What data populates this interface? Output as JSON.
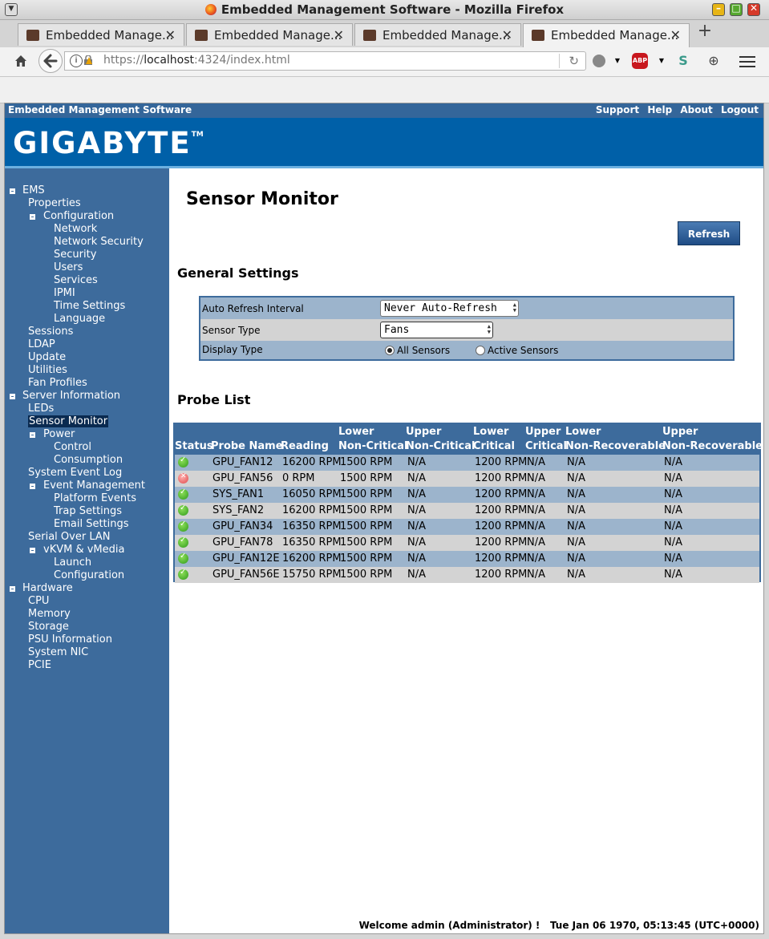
{
  "window": {
    "title": "Embedded Management Software - Mozilla Firefox"
  },
  "browser": {
    "tabs": [
      {
        "label": "Embedded Manage...",
        "active": false
      },
      {
        "label": "Embedded Manage...",
        "active": false
      },
      {
        "label": "Embedded Manage...",
        "active": false
      },
      {
        "label": "Embedded Manage...",
        "active": true
      }
    ],
    "url_scheme": "https://",
    "url_host": "localhost",
    "url_rest": ":4324/index.html",
    "abp_label": "ABP",
    "s_label": "S"
  },
  "app": {
    "title": "Embedded Management Software",
    "links": [
      "Support",
      "Help",
      "About",
      "Logout"
    ],
    "logo": "GIGABYTE",
    "logo_tm": "TM"
  },
  "sidebar": {
    "items": [
      {
        "label": "EMS",
        "level": 0,
        "toggle": true
      },
      {
        "label": "Properties",
        "level": 1
      },
      {
        "label": "Configuration",
        "level": 1,
        "toggle": true
      },
      {
        "label": "Network",
        "level": 2
      },
      {
        "label": "Network Security",
        "level": 2
      },
      {
        "label": "Security",
        "level": 2
      },
      {
        "label": "Users",
        "level": 2
      },
      {
        "label": "Services",
        "level": 2
      },
      {
        "label": "IPMI",
        "level": 2
      },
      {
        "label": "Time Settings",
        "level": 2
      },
      {
        "label": "Language",
        "level": 2
      },
      {
        "label": "Sessions",
        "level": 1
      },
      {
        "label": "LDAP",
        "level": 1
      },
      {
        "label": "Update",
        "level": 1
      },
      {
        "label": "Utilities",
        "level": 1
      },
      {
        "label": "Fan Profiles",
        "level": 1
      },
      {
        "label": "Server Information",
        "level": 0,
        "toggle": true
      },
      {
        "label": "LEDs",
        "level": 1
      },
      {
        "label": "Sensor Monitor",
        "level": 1,
        "selected": true
      },
      {
        "label": "Power",
        "level": 1,
        "toggle": true
      },
      {
        "label": "Control",
        "level": 2
      },
      {
        "label": "Consumption",
        "level": 2
      },
      {
        "label": "System Event Log",
        "level": 1
      },
      {
        "label": "Event Management",
        "level": 1,
        "toggle": true
      },
      {
        "label": "Platform Events",
        "level": 2
      },
      {
        "label": "Trap Settings",
        "level": 2
      },
      {
        "label": "Email Settings",
        "level": 2
      },
      {
        "label": "Serial Over LAN",
        "level": 1
      },
      {
        "label": "vKVM & vMedia",
        "level": 1,
        "toggle": true
      },
      {
        "label": "Launch",
        "level": 2
      },
      {
        "label": "Configuration",
        "level": 2
      },
      {
        "label": "Hardware",
        "level": 0,
        "toggle": true
      },
      {
        "label": "CPU",
        "level": 1
      },
      {
        "label": "Memory",
        "level": 1
      },
      {
        "label": "Storage",
        "level": 1
      },
      {
        "label": "PSU Information",
        "level": 1
      },
      {
        "label": "System NIC",
        "level": 1
      },
      {
        "label": "PCIE",
        "level": 1
      }
    ]
  },
  "main": {
    "title": "Sensor Monitor",
    "refresh_label": "Refresh",
    "general_heading": "General Settings",
    "settings": {
      "auto_refresh_label": "Auto Refresh Interval",
      "auto_refresh_value": "Never Auto-Refresh",
      "sensor_type_label": "Sensor Type",
      "sensor_type_value": "Fans",
      "display_type_label": "Display Type",
      "display_all": "All Sensors",
      "display_active": "Active Sensors",
      "display_selected": "All Sensors"
    },
    "probe_heading": "Probe List",
    "columns": [
      {
        "line1": "",
        "line2": "Status"
      },
      {
        "line1": "",
        "line2": "Probe Name"
      },
      {
        "line1": "",
        "line2": "Reading"
      },
      {
        "line1": "Lower",
        "line2": "Non-Critical"
      },
      {
        "line1": "Upper",
        "line2": "Non-Critical"
      },
      {
        "line1": "Lower",
        "line2": "Critical"
      },
      {
        "line1": "Upper",
        "line2": "Critical"
      },
      {
        "line1": "Lower",
        "line2": "Non-Recoverable"
      },
      {
        "line1": "Upper",
        "line2": "Non-Recoverable"
      }
    ],
    "rows": [
      {
        "status": "ok",
        "name": "GPU_FAN12",
        "reading": "16200 RPM",
        "lnc": "1500 RPM",
        "unc": "N/A",
        "lc": "1200 RPM",
        "uc": "N/A",
        "lnr": "N/A",
        "unr": "N/A"
      },
      {
        "status": "critical",
        "name": "GPU_FAN56",
        "reading": "0 RPM",
        "lnc": "1500 RPM",
        "unc": "N/A",
        "lc": "1200 RPM",
        "uc": "N/A",
        "lnr": "N/A",
        "unr": "N/A"
      },
      {
        "status": "ok",
        "name": "SYS_FAN1",
        "reading": "16050 RPM",
        "lnc": "1500 RPM",
        "unc": "N/A",
        "lc": "1200 RPM",
        "uc": "N/A",
        "lnr": "N/A",
        "unr": "N/A"
      },
      {
        "status": "ok",
        "name": "SYS_FAN2",
        "reading": "16200 RPM",
        "lnc": "1500 RPM",
        "unc": "N/A",
        "lc": "1200 RPM",
        "uc": "N/A",
        "lnr": "N/A",
        "unr": "N/A"
      },
      {
        "status": "ok",
        "name": "GPU_FAN34",
        "reading": "16350 RPM",
        "lnc": "1500 RPM",
        "unc": "N/A",
        "lc": "1200 RPM",
        "uc": "N/A",
        "lnr": "N/A",
        "unr": "N/A"
      },
      {
        "status": "ok",
        "name": "GPU_FAN78",
        "reading": "16350 RPM",
        "lnc": "1500 RPM",
        "unc": "N/A",
        "lc": "1200 RPM",
        "uc": "N/A",
        "lnr": "N/A",
        "unr": "N/A"
      },
      {
        "status": "ok",
        "name": "GPU_FAN12E",
        "reading": "16200 RPM",
        "lnc": "1500 RPM",
        "unc": "N/A",
        "lc": "1200 RPM",
        "uc": "N/A",
        "lnr": "N/A",
        "unr": "N/A"
      },
      {
        "status": "ok",
        "name": "GPU_FAN56E",
        "reading": "15750 RPM",
        "lnc": "1500 RPM",
        "unc": "N/A",
        "lc": "1200 RPM",
        "uc": "N/A",
        "lnr": "N/A",
        "unr": "N/A"
      }
    ]
  },
  "footer": {
    "welcome": "Welcome admin (Administrator) !",
    "datetime": "Tue Jan 06 1970, 05:13:45 (UTC+0000)"
  },
  "colors": {
    "sidebar": "#3d6b9c",
    "banner": "#0060a8",
    "header": "#34669a"
  }
}
